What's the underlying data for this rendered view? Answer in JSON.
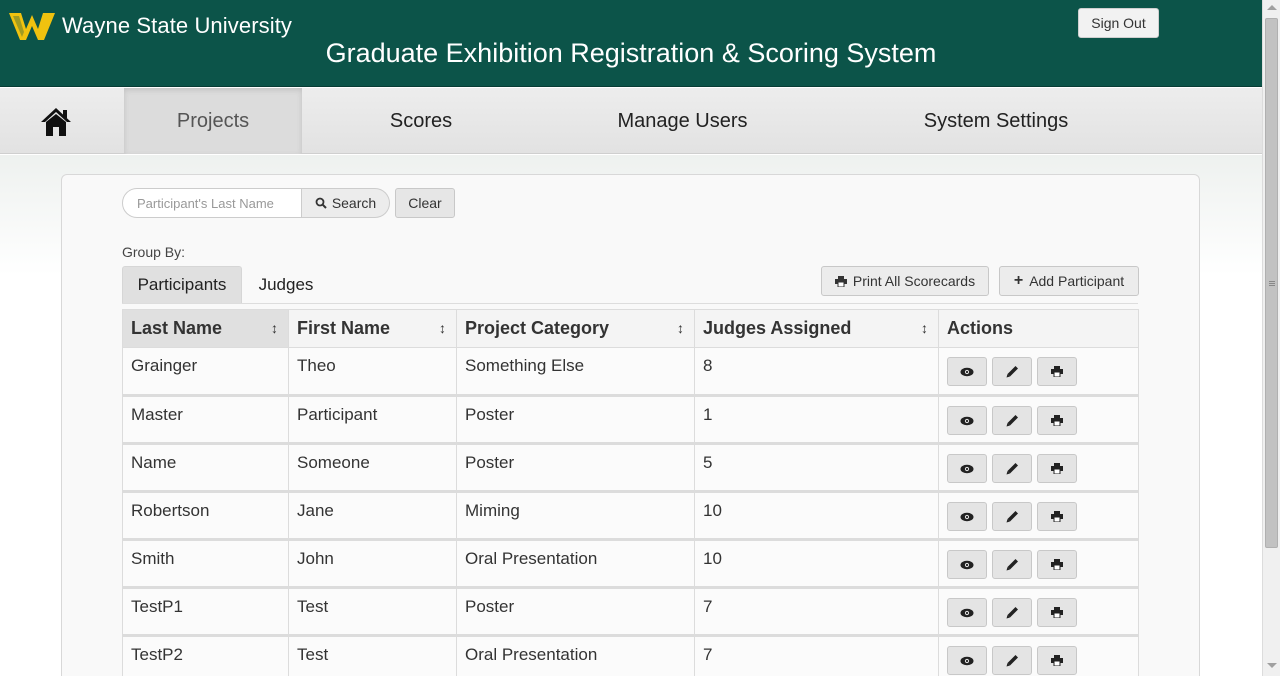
{
  "header": {
    "university": "Wayne State University",
    "title": "Graduate Exhibition Registration & Scoring System",
    "signout_label": "Sign Out",
    "colors": {
      "brand_green": "#0c5449",
      "logo_gold": "#f0c20f"
    }
  },
  "nav": {
    "home_icon": "home-icon",
    "items": [
      {
        "label": "Projects",
        "active": true
      },
      {
        "label": "Scores",
        "active": false
      },
      {
        "label": "Manage Users",
        "active": false
      },
      {
        "label": "System Settings",
        "active": false
      }
    ]
  },
  "search": {
    "placeholder": "Participant's Last Name",
    "button_label": "Search",
    "clear_label": "Clear"
  },
  "group_by": {
    "label": "Group By:",
    "tabs": [
      {
        "label": "Participants",
        "active": true
      },
      {
        "label": "Judges",
        "active": false
      }
    ]
  },
  "toolbar": {
    "print_all_label": "Print All Scorecards",
    "add_participant_label": "Add Participant"
  },
  "table": {
    "columns": [
      "Last Name",
      "First Name",
      "Project Category",
      "Judges Assigned",
      "Actions"
    ],
    "sorted_column": "Last Name",
    "rows": [
      {
        "last": "Grainger",
        "first": "Theo",
        "category": "Something Else",
        "judges": "8"
      },
      {
        "last": "Master",
        "first": "Participant",
        "category": "Poster",
        "judges": "1"
      },
      {
        "last": "Name",
        "first": "Someone",
        "category": "Poster",
        "judges": "5"
      },
      {
        "last": "Robertson",
        "first": "Jane",
        "category": "Miming",
        "judges": "10"
      },
      {
        "last": "Smith",
        "first": "John",
        "category": "Oral Presentation",
        "judges": "10"
      },
      {
        "last": "TestP1",
        "first": "Test",
        "category": "Poster",
        "judges": "7"
      },
      {
        "last": "TestP2",
        "first": "Test",
        "category": "Oral Presentation",
        "judges": "7"
      }
    ],
    "action_icons": [
      "eye-icon",
      "pencil-icon",
      "printer-icon"
    ]
  }
}
